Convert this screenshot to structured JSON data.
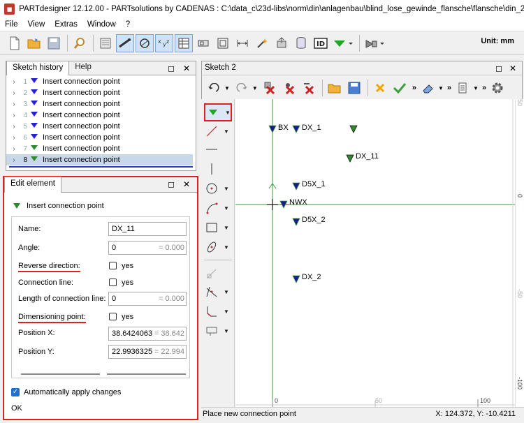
{
  "window": {
    "title": "PARTdesigner 12.12.00 - PARTsolutions by CADENAS : C:\\data_c\\23d-libs\\norm\\din\\anlagenbau\\blind_lose_gewinde_flansche\\flansche\\din_2573.prj",
    "icon": "cadenas-app-icon"
  },
  "menu": [
    "File",
    "View",
    "Extras",
    "Window",
    "?"
  ],
  "toolbar": {
    "unit_label": "Unit: mm",
    "id_label": "ID"
  },
  "sketch_history": {
    "tab_active": "Sketch history",
    "tab_inactive": "Help",
    "rows": [
      {
        "num": "1",
        "label": "Insert connection point",
        "color": "#2a1fd6"
      },
      {
        "num": "2",
        "label": "Insert connection point",
        "color": "#2a1fd6"
      },
      {
        "num": "3",
        "label": "Insert connection point",
        "color": "#2a1fd6"
      },
      {
        "num": "4",
        "label": "Insert connection point",
        "color": "#2a1fd6"
      },
      {
        "num": "5",
        "label": "Insert connection point",
        "color": "#2a1fd6"
      },
      {
        "num": "6",
        "label": "Insert connection point",
        "color": "#2a1fd6"
      },
      {
        "num": "7",
        "label": "Insert connection point",
        "color": "#2e8b2e"
      },
      {
        "num": "8",
        "label": "Insert connection point",
        "color": "#2e8b2e"
      }
    ]
  },
  "edit_element": {
    "tab": "Edit element",
    "header": "Insert connection point",
    "name_label": "Name:",
    "name_value": "DX_11",
    "angle_label": "Angle:",
    "angle_value": "0",
    "angle_eval": "= 0.000",
    "reverse_label": "Reverse direction:",
    "reverse_yes": "yes",
    "conn_line_label": "Connection line:",
    "conn_line_yes": "yes",
    "length_label": "Length of connection line:",
    "length_value": "0",
    "length_eval": "= 0.000",
    "dim_point_label": "Dimensioning point:",
    "dim_point_yes": "yes",
    "pos_x_label": "Position X:",
    "pos_x_value": "38.642406315",
    "pos_x_eval": "= 38.642",
    "pos_y_label": "Position Y:",
    "pos_y_value": "22.993632512",
    "pos_y_eval": "= 22.994",
    "auto_apply_label": "Automatically apply changes",
    "ok_label": "OK"
  },
  "sketch": {
    "tab": "Sketch 2",
    "points": [
      {
        "label": "BX"
      },
      {
        "label": "DX_1"
      },
      {
        "label": "DX_11"
      },
      {
        "label": "D5X_1"
      },
      {
        "label": "NWX"
      },
      {
        "label": "D5X_2"
      },
      {
        "label": "DX_2"
      }
    ],
    "ruler_bottom": [
      "0",
      "50",
      "100"
    ],
    "ruler_right": [
      "0",
      "-50",
      "-100",
      "-50"
    ],
    "ruler_right_top": "50"
  },
  "status": {
    "message": "Place new connection point",
    "coords": "X: 124.372, Y: -10.4211"
  },
  "colors": {
    "highlight_red": "#e02020",
    "selection_blue": "#1f3fbf",
    "marker_blue": "#1a1a8c",
    "marker_green": "#2e8b2e",
    "axis_green": "#3a9a3a"
  }
}
